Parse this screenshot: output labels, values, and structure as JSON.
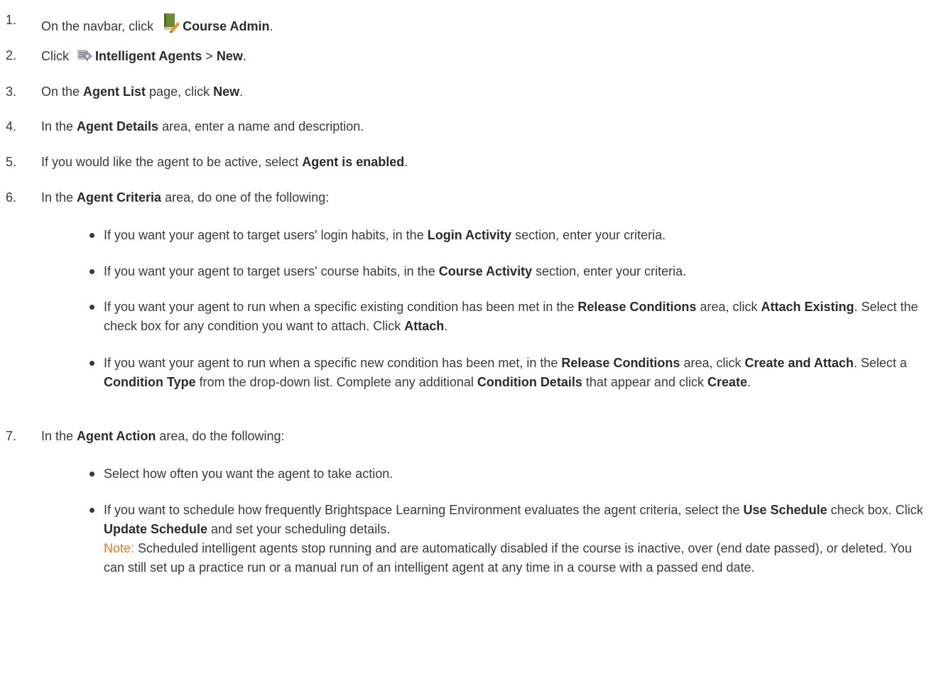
{
  "steps": [
    {
      "n": "1.",
      "pre": "On the navbar, click",
      "bold": "Course Admin",
      "post": ".",
      "icon": "course-admin-icon"
    },
    {
      "n": "2.",
      "pre": "Click",
      "bold": "Intelligent Agents",
      "mid": " > ",
      "bold2": "New",
      "post": ".",
      "icon": "intelligent-agents-icon"
    },
    {
      "n": "3.",
      "pre": "On the ",
      "bold": "Agent List",
      "mid": " page, click ",
      "bold2": "New",
      "post": "."
    },
    {
      "n": "4.",
      "pre": "In the ",
      "bold": "Agent Details",
      "post": " area, enter a name and description."
    },
    {
      "n": "5.",
      "pre": "If you would like the agent to be active, select ",
      "bold": "Agent is enabled",
      "post": "."
    },
    {
      "n": "6.",
      "pre": "In the ",
      "bold": "Agent Criteria",
      "post": " area, do one of the following:"
    },
    {
      "n": "7.",
      "pre": "In the ",
      "bold": "Agent Action",
      "post": " area, do the following:"
    }
  ],
  "criteria_bullets": [
    {
      "t1": "If you want your agent to target users' login habits, in the ",
      "b1": "Login Activity",
      "t2": " section, enter your criteria."
    },
    {
      "t1": "If you want your agent to target users' course habits, in the ",
      "b1": "Course Activity",
      "t2": " section, enter your criteria."
    },
    {
      "t1": "If you want your agent to run when a specific existing condition has been met in the ",
      "b1": "Release Conditions",
      "t2": " area, click ",
      "b2": "Attach Existing",
      "t3": ". Select the check box for any condition you want to attach. Click ",
      "b3": "Attach",
      "t4": "."
    },
    {
      "t1": "If you want your agent to run when a specific new condition has been met, in the ",
      "b1": "Release Conditions",
      "t2": " area, click ",
      "b2": "Create and Attach",
      "t3": ". Select a ",
      "b3": "Condition Type",
      "t4": " from the drop-down list. Complete any additional ",
      "b4": "Condition Details",
      "t5": " that appear and click ",
      "b5": "Create",
      "t6": "."
    }
  ],
  "action_bullets": [
    {
      "t1": "Select how often you want the agent to take action."
    },
    {
      "t1": "If you want to schedule how frequently Brightspace Learning Environment evaluates the agent criteria, select the ",
      "b1": "Use Schedule",
      "t2": " check box. Click ",
      "b2": "Update Schedule",
      "t3": " and set your scheduling details."
    }
  ],
  "note": {
    "label": "Note:",
    "text": " Scheduled intelligent agents stop running and are automatically disabled if the course is inactive, over (end date passed), or deleted. You can still set up a practice run or a manual run of an intelligent agent at any time in a course with a passed end date."
  },
  "colors": {
    "note_label": "#e8762b",
    "text": "#3a3a3a"
  }
}
